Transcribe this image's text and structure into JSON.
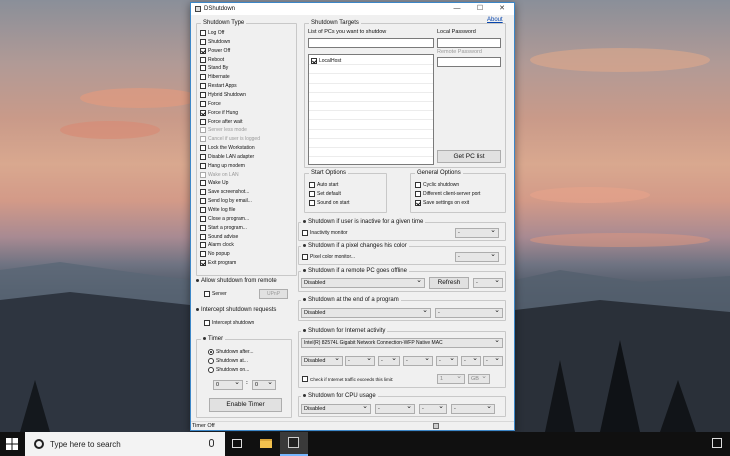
{
  "window": {
    "title": "DShutdown",
    "about_link": "About",
    "minimize": "—",
    "maximize": "☐",
    "close": "✕"
  },
  "shutdown_type": {
    "title": "Shutdown Type",
    "items": [
      {
        "label": "Log Off",
        "checked": false,
        "disabled": false
      },
      {
        "label": "Shutdown",
        "checked": false,
        "disabled": false
      },
      {
        "label": "Power Off",
        "checked": true,
        "disabled": false
      },
      {
        "label": "Reboot",
        "checked": false,
        "disabled": false
      },
      {
        "label": "Stand By",
        "checked": false,
        "disabled": false
      },
      {
        "label": "Hibernate",
        "checked": false,
        "disabled": false
      },
      {
        "label": "Restart Apps",
        "checked": false,
        "disabled": false
      },
      {
        "label": "Hybrid Shutdown",
        "checked": false,
        "disabled": false
      },
      {
        "label": "Force",
        "checked": false,
        "disabled": false
      },
      {
        "label": "Force if Hung",
        "checked": true,
        "disabled": false
      },
      {
        "label": "Force after wait",
        "checked": false,
        "disabled": false
      },
      {
        "label": "Server less mode",
        "checked": false,
        "disabled": true
      },
      {
        "label": "Cancel if user is logged",
        "checked": false,
        "disabled": true
      },
      {
        "label": "Lock the Workstation",
        "checked": false,
        "disabled": false
      },
      {
        "label": "Disable LAN adapter",
        "checked": false,
        "disabled": false
      },
      {
        "label": "Hang up modem",
        "checked": false,
        "disabled": false
      },
      {
        "label": "Wake on LAN",
        "checked": false,
        "disabled": true
      },
      {
        "label": "Wake Up",
        "checked": false,
        "disabled": false
      },
      {
        "label": "Save screenshot...",
        "checked": false,
        "disabled": false
      },
      {
        "label": "Send log by email...",
        "checked": false,
        "disabled": false
      },
      {
        "label": "Write log file",
        "checked": false,
        "disabled": false
      },
      {
        "label": "Close a program...",
        "checked": false,
        "disabled": false
      },
      {
        "label": "Start a program...",
        "checked": false,
        "disabled": false
      },
      {
        "label": "Sound advise",
        "checked": false,
        "disabled": false
      },
      {
        "label": "Alarm clock",
        "checked": false,
        "disabled": false
      },
      {
        "label": "No popup",
        "checked": false,
        "disabled": false
      },
      {
        "label": "Exit program",
        "checked": true,
        "disabled": false
      }
    ]
  },
  "allow_remote": {
    "title": "Allow shutdown from remote",
    "server_label": "Server",
    "upnp_label": "UPnP"
  },
  "intercept": {
    "title": "Intercept shutdown requests",
    "checkbox_label": "Intercept shutdown"
  },
  "timer": {
    "title": "Timer",
    "options": [
      "Shutdown after...",
      "Shutdown at...",
      "Shutdown on..."
    ],
    "hours": "0",
    "minutes": "0",
    "sep": ":",
    "enable_button": "Enable Timer"
  },
  "targets": {
    "title": "Shutdown Targets",
    "list_label": "List of PCs you want to shutdow",
    "local_password_label": "Local Password",
    "remote_password_label": "Remote Password",
    "pc_entry": "LocalHost",
    "get_pc_button": "Get PC list"
  },
  "start_options": {
    "title": "Start Options",
    "items": [
      "Auto start",
      "Set default",
      "Sound on start"
    ]
  },
  "general_options": {
    "title": "General Options",
    "items": [
      {
        "label": "Cyclic shutdown",
        "checked": false
      },
      {
        "label": "Different client-server port",
        "checked": false
      },
      {
        "label": "Save settings on exit",
        "checked": true
      }
    ]
  },
  "inactive": {
    "title": "Shutdown if user is inactive for a given time",
    "check_label": "Inactivity monitor",
    "dropdown": "-"
  },
  "pixel": {
    "title": "Shutdown if a pixel changes his color",
    "check_label": "Pixel color monitor...",
    "dropdown": "-"
  },
  "remote_offline": {
    "title": "Shutdown if a remote PC goes offline",
    "dropdown": "Disabled",
    "refresh_button": "Refresh",
    "dropdown2": "-"
  },
  "end_program": {
    "title": "Shutdown at the end of a program",
    "dropdown": "Disabled",
    "dropdown2": "-"
  },
  "internet": {
    "title": "Shutdown for Internet activity",
    "adapter": "Intel(R) 82574L Gigabit Network Connection-WFP Native MAC",
    "mode": "Disabled",
    "dashes": [
      "-",
      "-",
      "-",
      "-",
      "-",
      "-"
    ],
    "check_label": "Check if Internet traffic exceeds this limit:",
    "limit_value": "1",
    "limit_unit": "GB"
  },
  "cpu": {
    "title": "Shutdown for CPU usage",
    "mode": "Disabled",
    "dashes": [
      "-",
      "-",
      "-"
    ]
  },
  "status": {
    "text": "Timer Off"
  },
  "taskbar": {
    "search_placeholder": "Type here to search"
  }
}
